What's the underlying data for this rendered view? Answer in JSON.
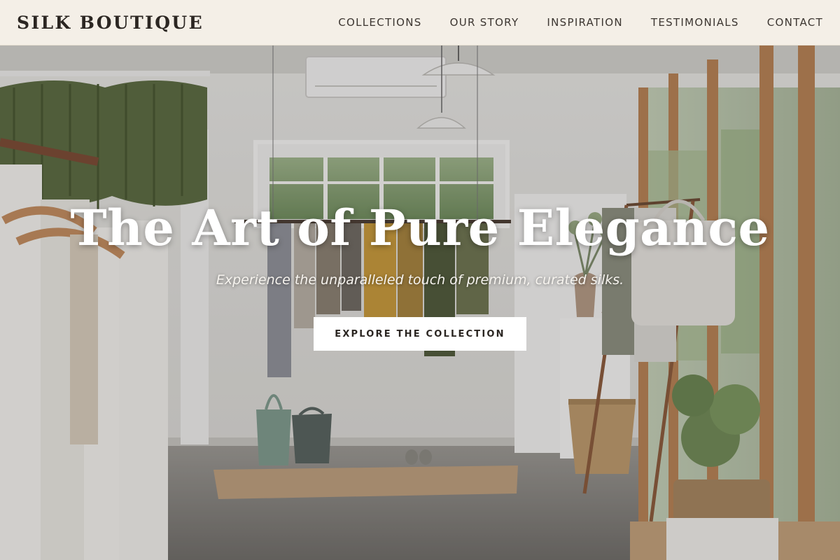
{
  "header": {
    "brand": "SILK BOUTIQUE",
    "nav": [
      {
        "label": "COLLECTIONS"
      },
      {
        "label": "OUR STORY"
      },
      {
        "label": "INSPIRATION"
      },
      {
        "label": "TESTIMONIALS"
      },
      {
        "label": "CONTACT"
      }
    ]
  },
  "hero": {
    "title": "The Art of Pure Elegance",
    "subtitle": "Experience the unparalleled touch of premium, curated silks.",
    "cta_label": "EXPLORE THE COLLECTION"
  },
  "colors": {
    "header_bg": "#f4efe7",
    "text_dark": "#2b2622",
    "cta_bg": "#ffffff",
    "hero_text": "#ffffff"
  }
}
